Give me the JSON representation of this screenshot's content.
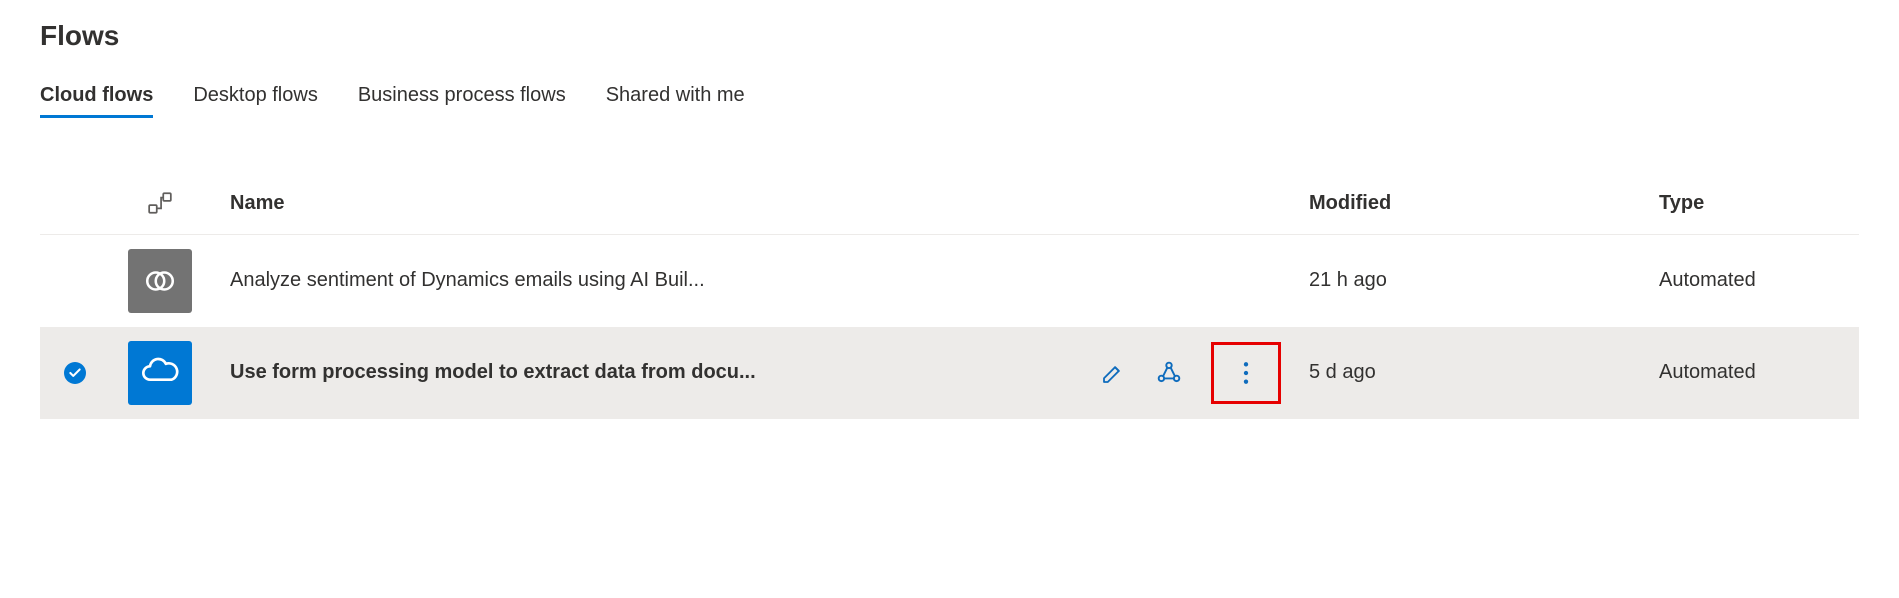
{
  "page": {
    "title": "Flows"
  },
  "tabs": [
    {
      "label": "Cloud flows",
      "active": true
    },
    {
      "label": "Desktop flows",
      "active": false
    },
    {
      "label": "Business process flows",
      "active": false
    },
    {
      "label": "Shared with me",
      "active": false
    }
  ],
  "columns": {
    "name": "Name",
    "modified": "Modified",
    "type": "Type"
  },
  "rows": [
    {
      "selected": false,
      "icon": "dynamics-icon",
      "iconColor": "gray",
      "name": "Analyze sentiment of Dynamics emails using AI Buil...",
      "modified": "21 h ago",
      "type": "Automated"
    },
    {
      "selected": true,
      "icon": "onedrive-icon",
      "iconColor": "blue",
      "name": "Use form processing model to extract data from docu...",
      "modified": "5 d ago",
      "type": "Automated"
    }
  ]
}
